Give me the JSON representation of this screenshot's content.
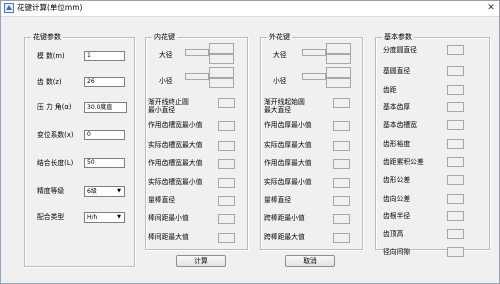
{
  "window": {
    "title": "花键计算(单位mm)",
    "close_glyph": "✕"
  },
  "spline_params": {
    "title": "花键参数",
    "modulus": {
      "label": "模    数(m)",
      "value": "1"
    },
    "teeth": {
      "label": "齿    数(z)",
      "value": "26"
    },
    "pressure_angle": {
      "label": "压 力 角(α)",
      "value": "30.0度直"
    },
    "shift_coef": {
      "label": "变位系数(x)",
      "value": "0"
    },
    "length": {
      "label": "结合长度(L)",
      "value": "50"
    },
    "accuracy": {
      "label": "精度等级",
      "value": "6级"
    },
    "fit": {
      "label": "配合类型",
      "value": "H/h"
    }
  },
  "internal": {
    "title": "内花键",
    "major_dia": "大径",
    "minor_dia": "小径",
    "involute_end": "渐开线终止圆\n最小直径",
    "space_width_min": "作用齿槽宽最小值",
    "actual_space_max": "实际齿槽宽最大值",
    "space_width_max": "作用齿槽宽最大值",
    "actual_space_min": "实际齿槽宽最小值",
    "pin_dia": "量棒直径",
    "pin_dist_min": "棒间距最小值",
    "pin_dist_max": "棒间距最大值"
  },
  "external": {
    "title": "外花键",
    "major_dia": "大径",
    "minor_dia": "小径",
    "involute_start": "渐开线起始圆\n最大直径",
    "thick_min": "作用齿厚最小值",
    "actual_thick_max": "实际齿厚最大值",
    "thick_max": "作用齿厚最大值",
    "actual_thick_min": "实际齿厚最小值",
    "pin_dia": "量棒直径",
    "span_min": "跨棒距最小值",
    "span_max": "跨棒距最大值"
  },
  "basic": {
    "title": "基本参数",
    "items": [
      "分度圆直径",
      "基圆直径",
      "齿距",
      "基本齿厚",
      "基本齿槽宽",
      "齿形裕度",
      "齿距累积公差",
      "齿形公差",
      "齿向公差",
      "齿根半径",
      "齿顶高",
      "径向间隙"
    ]
  },
  "buttons": {
    "calculate": "计算",
    "cancel": "取消"
  }
}
